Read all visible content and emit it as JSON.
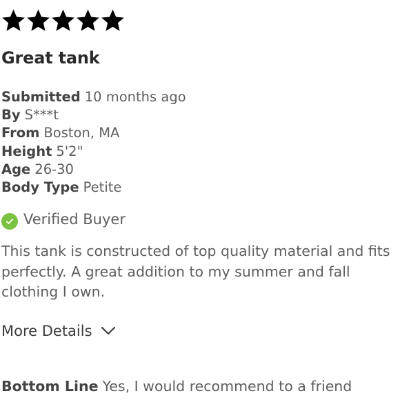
{
  "rating": {
    "value": 5,
    "max": 5,
    "icon": "star-icon",
    "color": "#000000"
  },
  "review": {
    "title": "Great tank",
    "submitted_label": "Submitted",
    "submitted_value": "10 months ago",
    "by_label": "By",
    "by_value": "S***t",
    "from_label": "From",
    "from_value": "Boston, MA",
    "height_label": "Height",
    "height_value": "5'2\"",
    "age_label": "Age",
    "age_value": "26-30",
    "body_type_label": "Body Type",
    "body_type_value": "Petite",
    "verified_label": "Verified Buyer",
    "verified_icon": "check-circle-icon",
    "verified_color": "#7cc242",
    "text": "This tank is constructed of top quality material and fits perfectly. A great addition to my summer and fall clothing I own.",
    "more_details_label": "More Details",
    "more_details_icon": "chevron-down-icon",
    "bottom_line_label": "Bottom Line",
    "bottom_line_value": "Yes, I would recommend to a friend"
  }
}
